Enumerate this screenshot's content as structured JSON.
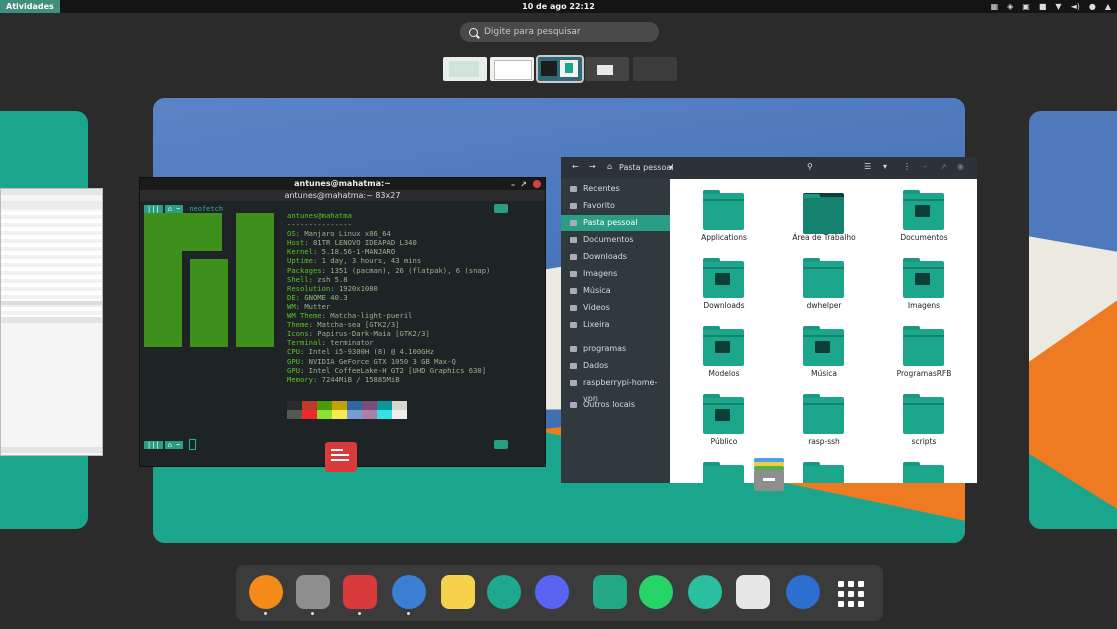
{
  "topbar": {
    "activities": "Atividades",
    "clock": "10 de ago  22:12",
    "tray_icons": [
      "apps-icon",
      "shield-icon",
      "clipboard-icon",
      "network-icon",
      "wifi-icon",
      "volume-icon",
      "microphone-icon",
      "power-icon"
    ]
  },
  "search": {
    "placeholder": "Digite para pesquisar"
  },
  "workspaces": {
    "count": 5,
    "active_index": 2
  },
  "terminal": {
    "title": "antunes@mahatma:~",
    "subtitle": "antunes@mahatma:~ 83x27",
    "command": "neofetch",
    "user_host": "antunes@mahatma",
    "rule": "---------------",
    "info": [
      {
        "key": "OS",
        "value": "Manjaro Linux x86_64"
      },
      {
        "key": "Host",
        "value": "81TR LENOVO IDEAPAD L340"
      },
      {
        "key": "Kernel",
        "value": "5.18.56-1-MANJARO"
      },
      {
        "key": "Uptime",
        "value": "1 day, 3 hours, 43 mins"
      },
      {
        "key": "Packages",
        "value": "1351 (pacman), 26 (flatpak), 6 (snap)"
      },
      {
        "key": "Shell",
        "value": "zsh 5.8"
      },
      {
        "key": "Resolution",
        "value": "1920x1080"
      },
      {
        "key": "DE",
        "value": "GNOME 40.3"
      },
      {
        "key": "WM",
        "value": "Mutter"
      },
      {
        "key": "WM Theme",
        "value": "Matcha-light-pueril"
      },
      {
        "key": "Theme",
        "value": "Matcha-sea [GTK2/3]"
      },
      {
        "key": "Icons",
        "value": "Papirus-Dark-Maia [GTK2/3]"
      },
      {
        "key": "Terminal",
        "value": "terminator"
      },
      {
        "key": "CPU",
        "value": "Intel i5-9300H (8) @ 4.100GHz"
      },
      {
        "key": "GPU",
        "value": "NVIDIA GeForce GTX 1050 3 GB Max-Q"
      },
      {
        "key": "GPU",
        "value": "Intel CoffeeLake-H GT2 [UHD Graphics 630]"
      },
      {
        "key": "Memory",
        "value": "7244MiB / 15885MiB"
      }
    ],
    "palette_top": [
      "#2b2b2b",
      "#c0392b",
      "#4e9a06",
      "#c4a000",
      "#3465a4",
      "#75507b",
      "#06989a",
      "#d3d7cf"
    ],
    "palette_bottom": [
      "#555753",
      "#ef2929",
      "#8ae234",
      "#fce94f",
      "#729fcf",
      "#ad7fa8",
      "#34e2e2",
      "#eeeeec"
    ]
  },
  "file_manager": {
    "location": "Pasta pessoal",
    "sidebar": [
      {
        "label": "Recentes",
        "icon": "clock-icon"
      },
      {
        "label": "Favorito",
        "icon": "star-icon"
      },
      {
        "label": "Pasta pessoal",
        "icon": "home-icon"
      },
      {
        "label": "Documentos",
        "icon": "document-icon"
      },
      {
        "label": "Downloads",
        "icon": "download-icon"
      },
      {
        "label": "Imagens",
        "icon": "image-icon"
      },
      {
        "label": "Música",
        "icon": "music-icon"
      },
      {
        "label": "Vídeos",
        "icon": "video-icon"
      },
      {
        "label": "Lixeira",
        "icon": "trash-icon"
      },
      {
        "label": "programas",
        "icon": "folder-icon"
      },
      {
        "label": "Dados",
        "icon": "drive-icon"
      },
      {
        "label": "raspberrypi-home-vpn",
        "icon": "network-icon"
      },
      {
        "label": "Outros locais",
        "icon": "plus-icon"
      }
    ],
    "folders": [
      {
        "label": "Applications",
        "glyph": ""
      },
      {
        "label": "Área de Trabalho",
        "glyph": "desktop"
      },
      {
        "label": "Documentos",
        "glyph": "doc"
      },
      {
        "label": "Downloads",
        "glyph": "down"
      },
      {
        "label": "dwhelper",
        "glyph": ""
      },
      {
        "label": "Imagens",
        "glyph": "img"
      },
      {
        "label": "Modelos",
        "glyph": "doc"
      },
      {
        "label": "Música",
        "glyph": "music"
      },
      {
        "label": "ProgramasRFB",
        "glyph": ""
      },
      {
        "label": "Público",
        "glyph": "user"
      },
      {
        "label": "rasp-ssh",
        "glyph": ""
      },
      {
        "label": "scripts",
        "glyph": ""
      }
    ]
  },
  "dock": {
    "apps": [
      {
        "name": "firefox-icon",
        "color": "#f48a1a",
        "running": true
      },
      {
        "name": "file-manager-icon",
        "color": "#8e8e8e",
        "running": true
      },
      {
        "name": "document-viewer-icon",
        "color": "#d93a3a",
        "running": true
      },
      {
        "name": "thunderbird-icon",
        "color": "#3b7fd4",
        "running": true
      },
      {
        "name": "text-editor-icon",
        "color": "#f6d24a",
        "running": false
      },
      {
        "name": "camera-aperture-icon",
        "color": "#1ea88e",
        "running": false
      },
      {
        "name": "discord-icon",
        "color": "#5865f2",
        "running": false
      },
      {
        "name": "manjaro-settings-icon",
        "color": "#22a884",
        "running": false
      },
      {
        "name": "whatsapp-icon",
        "color": "#25d366",
        "running": false
      },
      {
        "name": "atom-icon",
        "color": "#2bbfa0",
        "running": false
      },
      {
        "name": "calculator-icon",
        "color": "#e6e6e6",
        "running": false
      },
      {
        "name": "remote-desktop-icon",
        "color": "#2d6fd0",
        "running": false
      }
    ],
    "app_grid": "show-apps-icon"
  }
}
